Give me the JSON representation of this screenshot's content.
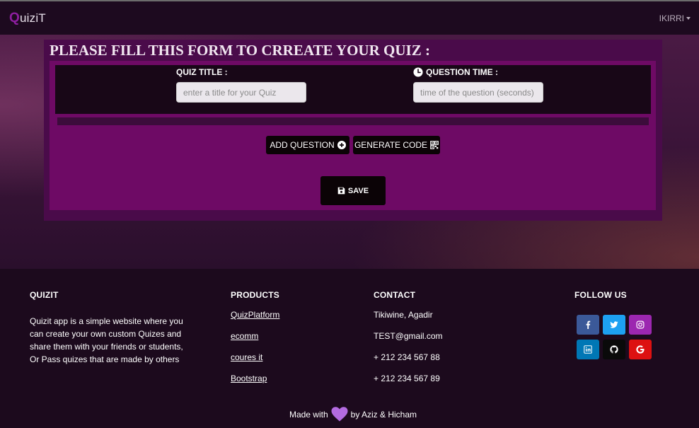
{
  "navbar": {
    "brand_first": "Q",
    "brand_rest": "uiziT",
    "user": "IKIRRI"
  },
  "form": {
    "title": "PLEASE FILL THIS FORM TO CRREATE YOUR QUIZ :",
    "quiz_title_label": "QUIZ TITLE :",
    "quiz_title_placeholder": "enter a title for your Quiz",
    "quiz_title_value": "",
    "question_time_label": "QUESTION TIME :",
    "question_time_placeholder": "time of the question (seconds)",
    "question_time_value": "",
    "add_question_label": "ADD QUESTION",
    "generate_code_label": "GENERATE CODE",
    "save_label": "SAVE"
  },
  "footer": {
    "quizit": {
      "heading": "QUIZIT",
      "text": "Quizit app is a simple website where you can create your own custom Quizes and share them with your friends or students, Or Pass quizes that are made by others"
    },
    "products": {
      "heading": "PRODUCTS",
      "items": [
        "QuizPlatform",
        "ecomm",
        "coures it",
        "Bootstrap"
      ]
    },
    "contact": {
      "heading": "CONTACT",
      "items": [
        "Tikiwine, Agadir",
        "TEST@gmail.com",
        "+ 212 234 567 88",
        "+ 212 234 567 89"
      ]
    },
    "follow": {
      "heading": "FOLLOW US",
      "icons": [
        {
          "name": "facebook-icon",
          "color": "#3b5998"
        },
        {
          "name": "twitter-icon",
          "color": "#1da1f2"
        },
        {
          "name": "instagram-icon",
          "color": "#9c27b0"
        },
        {
          "name": "linkedin-icon",
          "color": "#0077b5"
        },
        {
          "name": "github-icon",
          "color": "#0a0a0a"
        },
        {
          "name": "google-icon",
          "color": "#dd1111"
        }
      ]
    },
    "made_with_prefix": "Made with",
    "made_with_suffix": "by Aziz & Hicham"
  },
  "colors": {
    "navbar_bg": "#1d0a1f",
    "brand_accent": "#8e1ea0",
    "form_panel": "#4a0b4a",
    "form_inner": "#6e0a65",
    "heart": "#b36be0"
  }
}
